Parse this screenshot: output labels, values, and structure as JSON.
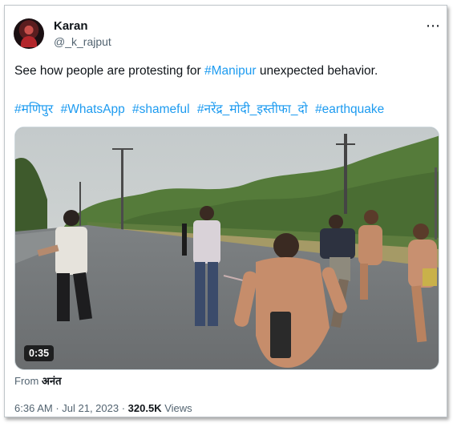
{
  "user": {
    "name": "Karan",
    "handle": "@_k_rajput"
  },
  "tweet": {
    "text_before": "See how people are protesting for ",
    "text_tag": "#Manipur",
    "text_after": " unexpected behavior.",
    "hashtags": [
      "#मणिपुर",
      "#WhatsApp",
      "#shameful",
      "#नरेंद्र_मोदी_इस्तीफा_दो",
      "#earthquake"
    ]
  },
  "media": {
    "duration": "0:35"
  },
  "source": {
    "prefix": "From ",
    "name": "अनंत"
  },
  "meta": {
    "time": "6:36 AM",
    "separator": " · ",
    "date": "Jul 21, 2023",
    "views_count": "320.5K",
    "views_label": " Views"
  },
  "more_icon": "⋯",
  "colors": {
    "link": "#1d9bf0",
    "secondary": "#536471",
    "text": "#0f1419"
  }
}
